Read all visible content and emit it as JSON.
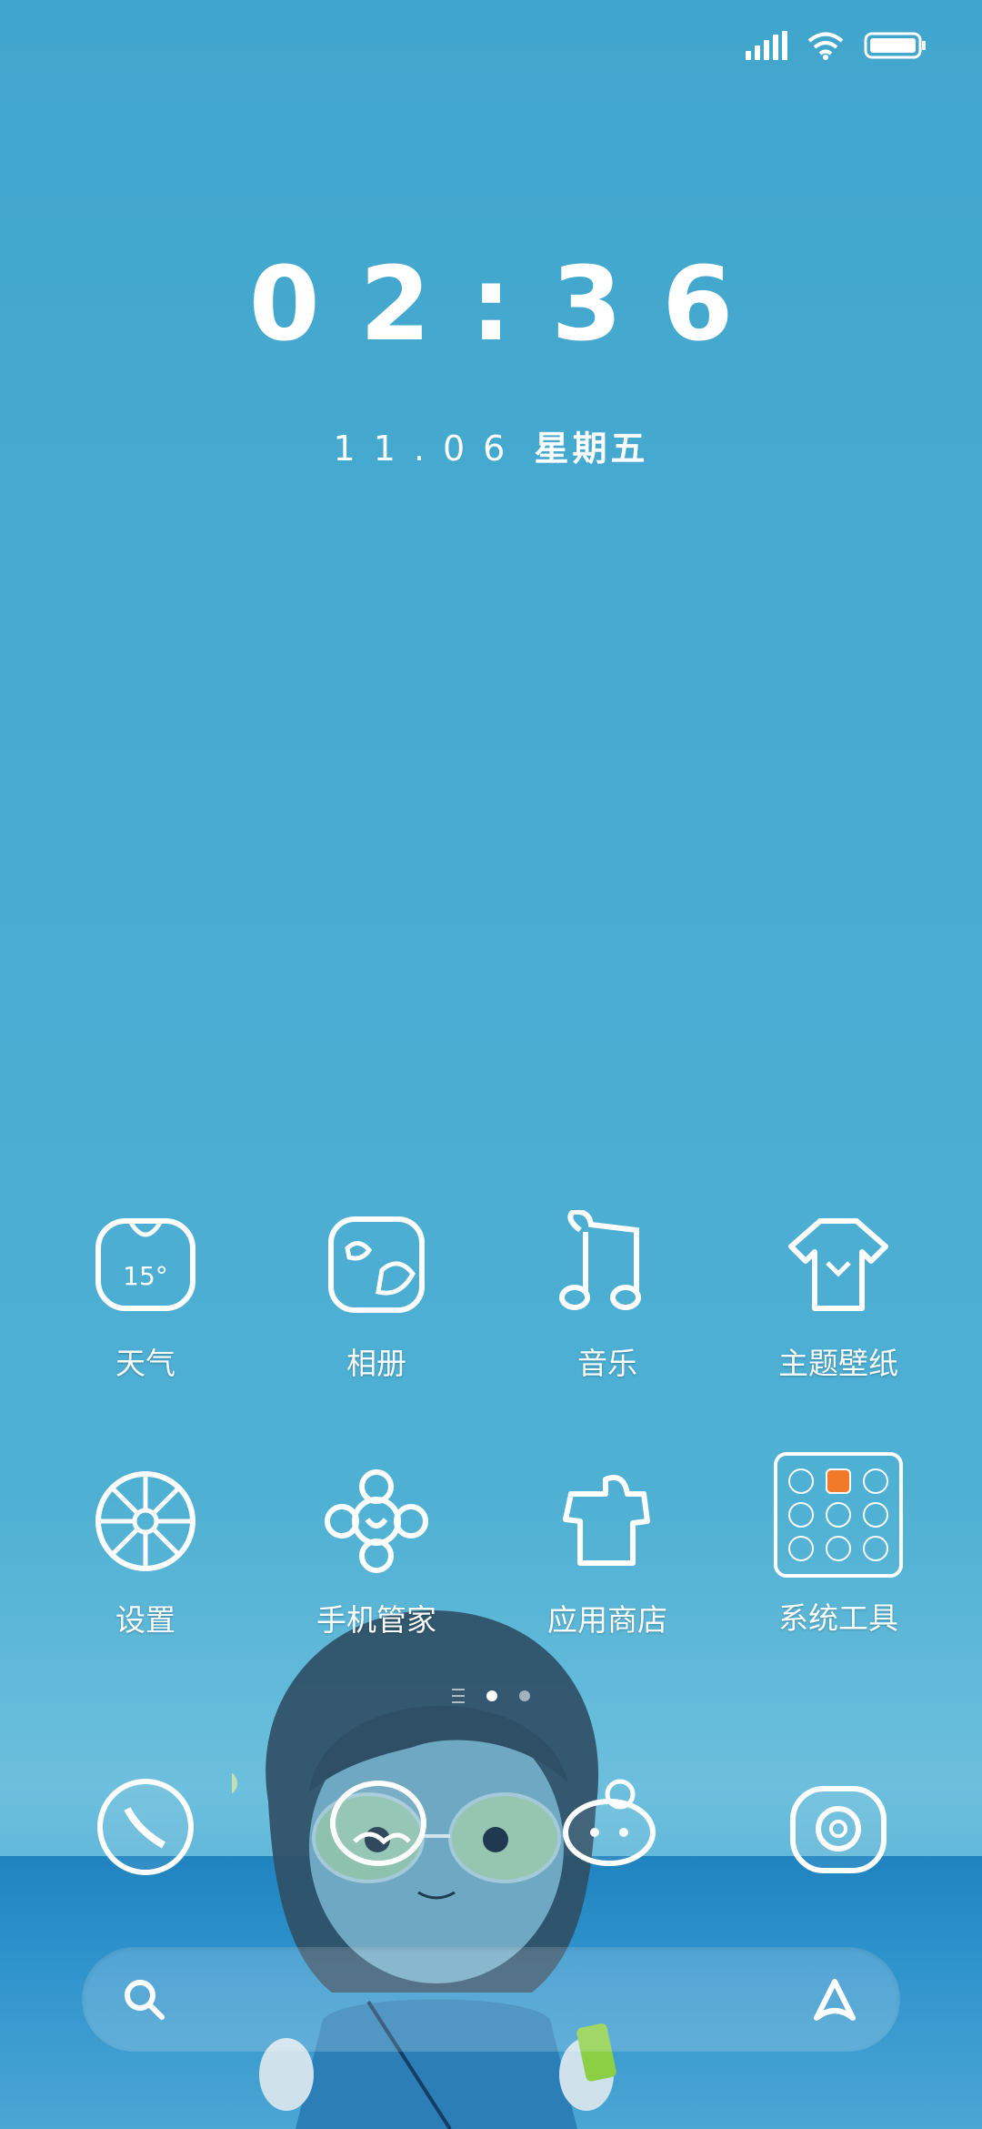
{
  "status_bar": {
    "icons": [
      "signal-icon",
      "wifi-icon",
      "battery-icon"
    ]
  },
  "lockscreen": {
    "time": "02:36",
    "date": "11.06",
    "weekday": "星期五"
  },
  "apps_row1": [
    {
      "label": "天气",
      "icon": "weather-icon",
      "temp": "15°"
    },
    {
      "label": "相册",
      "icon": "gallery-icon"
    },
    {
      "label": "音乐",
      "icon": "music-icon"
    },
    {
      "label": "主题壁纸",
      "icon": "theme-shirt-icon"
    }
  ],
  "apps_row2": [
    {
      "label": "设置",
      "icon": "settings-icon"
    },
    {
      "label": "手机管家",
      "icon": "security-icon"
    },
    {
      "label": "应用商店",
      "icon": "app-store-icon"
    },
    {
      "label": "系统工具",
      "icon": "folder-icon"
    }
  ],
  "page_indicator": {
    "pages": 2,
    "active": 1
  },
  "dock": [
    {
      "icon": "phone-icon"
    },
    {
      "icon": "messages-icon"
    },
    {
      "icon": "chat-icon"
    },
    {
      "icon": "camera-icon"
    }
  ],
  "search_bar": {
    "left_icon": "search-icon",
    "right_icon": "assistant-icon"
  }
}
